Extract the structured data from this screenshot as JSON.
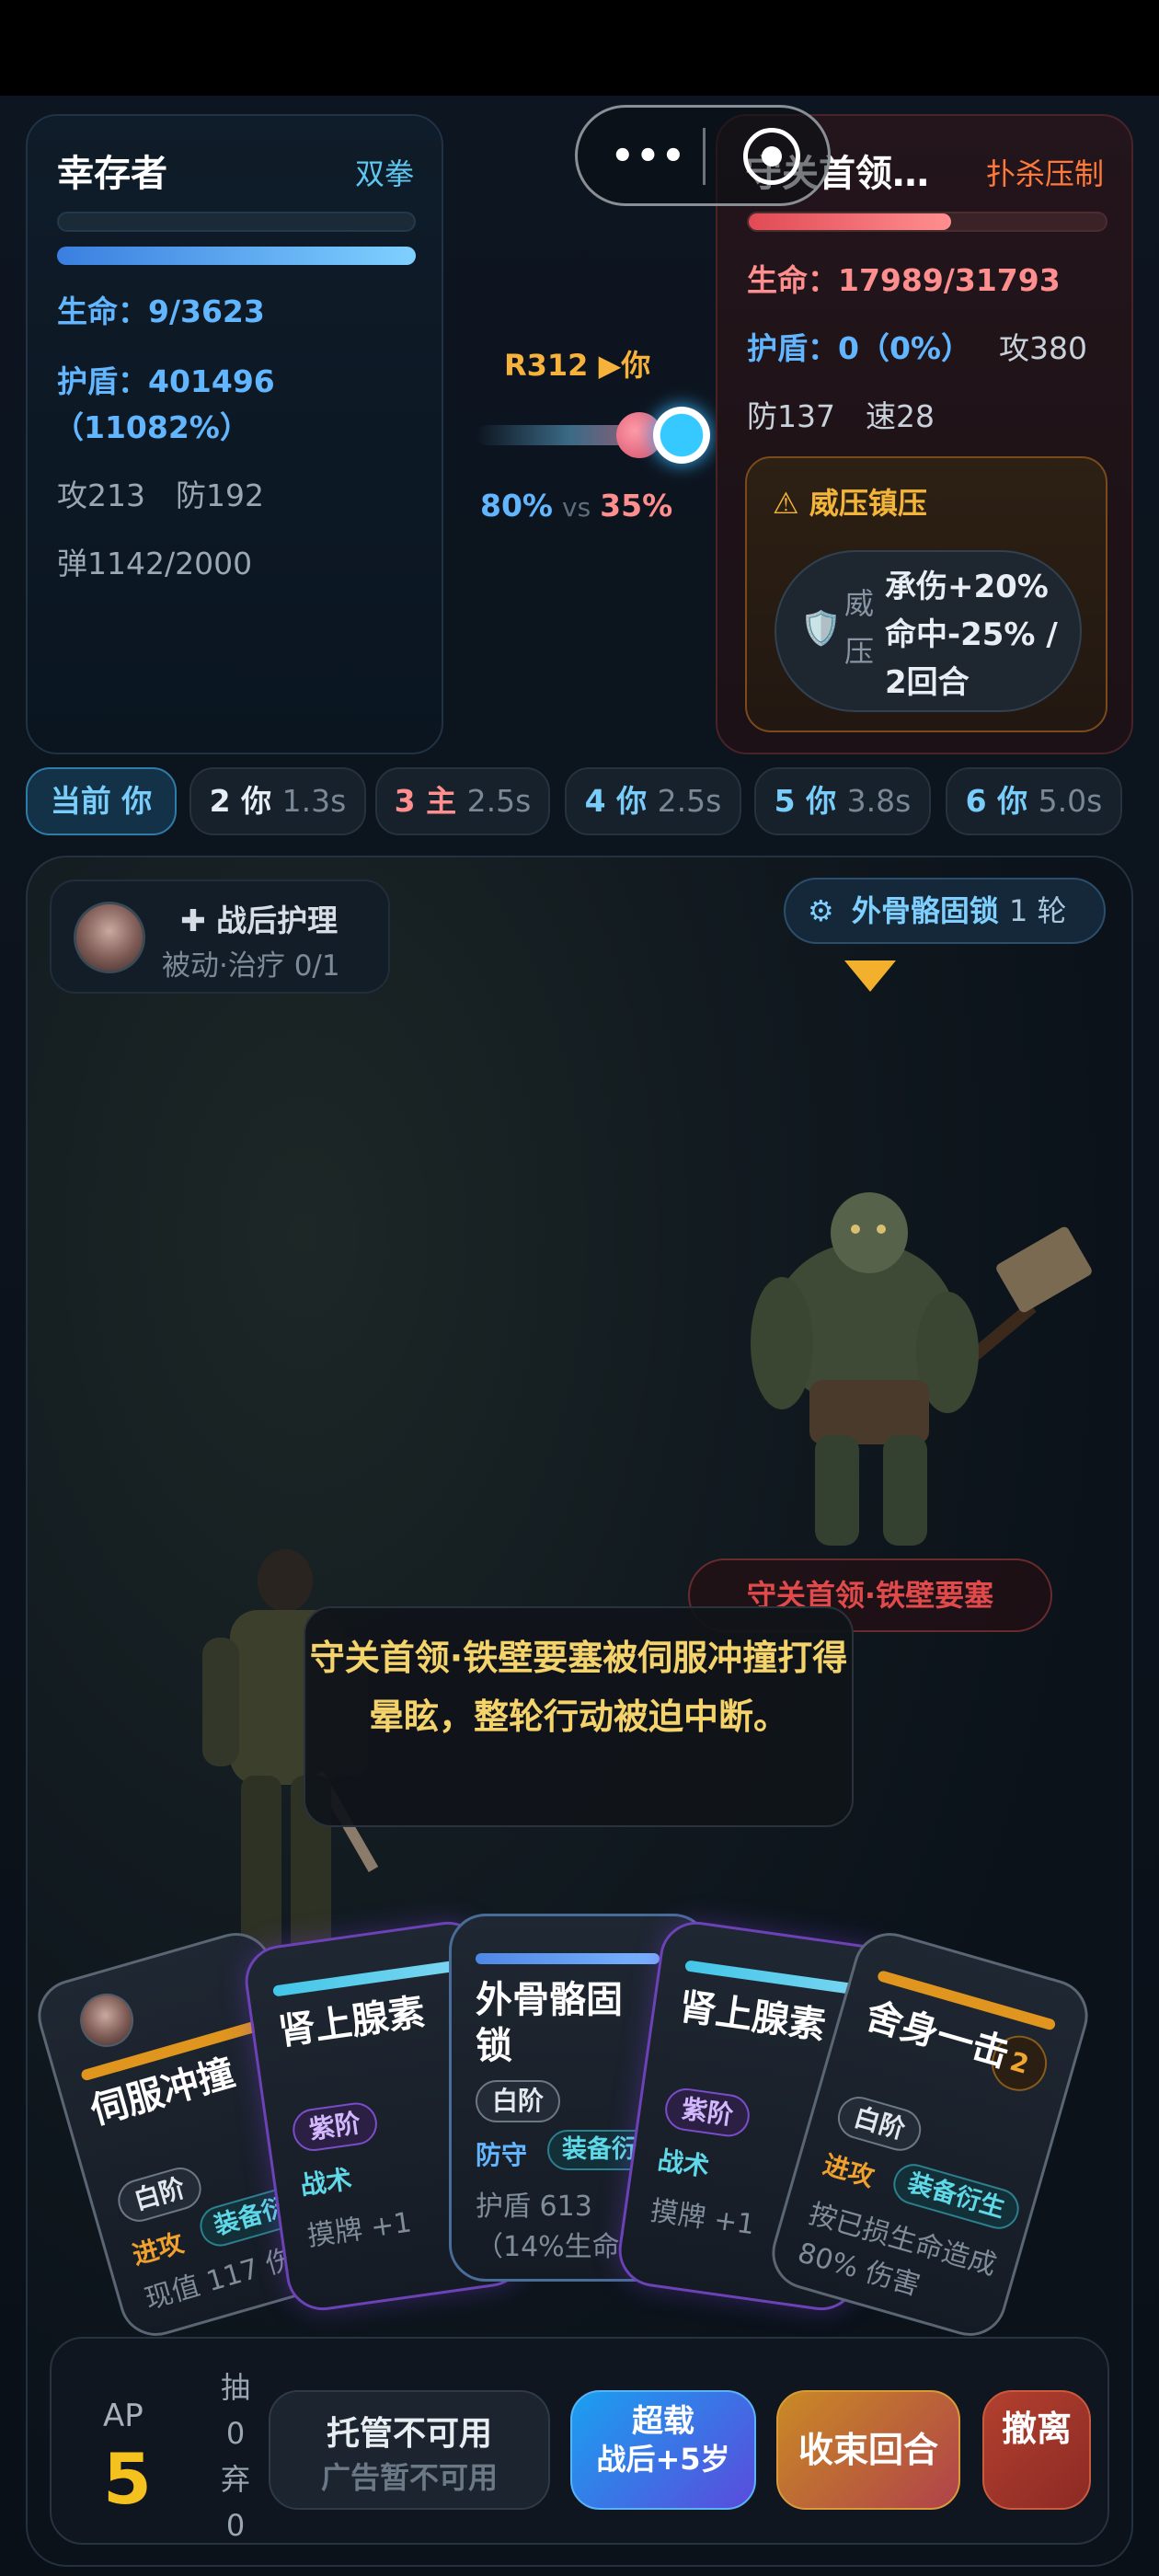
{
  "player": {
    "name": "幸存者",
    "style": "双拳",
    "hp_label": "生命：9/3623",
    "hp_fraction": 0.0,
    "shield_label": "护盾：401496",
    "shield_pct": "（11082%）",
    "shield_fraction": 1.0,
    "atk_def": "攻213　防192",
    "ammo": "弹1142/2000"
  },
  "center": {
    "round": "R312 ▶你",
    "player_pct": "80%",
    "vs": "vs",
    "enemy_pct": "35%"
  },
  "boss": {
    "name": "守关首领…",
    "tag": "扑杀压制",
    "hp_label": "生命：17989/31793",
    "hp_fraction": 0.566,
    "shield_label": "护盾：0（0%）",
    "atk": "攻380",
    "def_spd": "防137　速28",
    "status": {
      "title": "威压镇压",
      "short": "威压",
      "effect": "承伤+20% 命中-25% / 2回合"
    }
  },
  "capsule": {
    "dots": "•••"
  },
  "turn_order": [
    {
      "label": "当前 你",
      "time": "",
      "active": true
    },
    {
      "label": "2 你",
      "time": "1.3s",
      "active": false
    },
    {
      "label": "3 主",
      "time": "2.5s",
      "active": false
    },
    {
      "label": "4 你",
      "time": "2.5s",
      "active": false
    },
    {
      "label": "5 你",
      "time": "3.8s",
      "active": false
    },
    {
      "label": "6 你",
      "time": "5.0s",
      "active": false
    }
  ],
  "passive": {
    "title": "✚ 战后护理",
    "sub": "被动·治疗 0/1"
  },
  "buff": {
    "icon": "gear-icon",
    "name": "外骨骼固锁",
    "count": "1 轮"
  },
  "boss_nameplate": "守关首领·铁壁要塞",
  "message": "守关首领·铁壁要塞被伺服冲撞打得晕眩，整轮行动被迫中断。",
  "cards": [
    {
      "name": "伺服冲撞",
      "rarity": "白阶",
      "type": "进攻",
      "sub": "装备衍生",
      "desc": "现值 117 伤害"
    },
    {
      "name": "肾上腺素",
      "rarity": "紫阶",
      "type": "战术",
      "sub": "",
      "desc": "摸牌 +1"
    },
    {
      "name": "外骨骼固锁",
      "rarity": "白阶",
      "type": "防守",
      "sub": "装备衍生",
      "desc": "护盾 613 （14%生命）"
    },
    {
      "name": "肾上腺素",
      "rarity": "紫阶",
      "type": "战术",
      "sub": "",
      "desc": "摸牌 +1"
    },
    {
      "name": "舍身一击",
      "rarity": "白阶",
      "type": "进攻",
      "sub": "装备衍生",
      "desc": "按已损生命造成 80% 伤害",
      "cost": "2"
    }
  ],
  "bottom": {
    "ap_label": "AP",
    "ap_value": "5",
    "draw_label": "抽",
    "draw_value": "0",
    "discard_label": "弃",
    "discard_value": "0",
    "auto_btn": "托管不可用",
    "auto_sub": "广告暂不可用",
    "overload_btn": "超载",
    "overload_sub": "战后+5岁",
    "end_btn": "收束回合",
    "flee_btn": "撤离"
  },
  "colors": {
    "accent_blue": "#62b6ff",
    "accent_red": "#ff8f8f",
    "gold": "#f5c11f"
  }
}
